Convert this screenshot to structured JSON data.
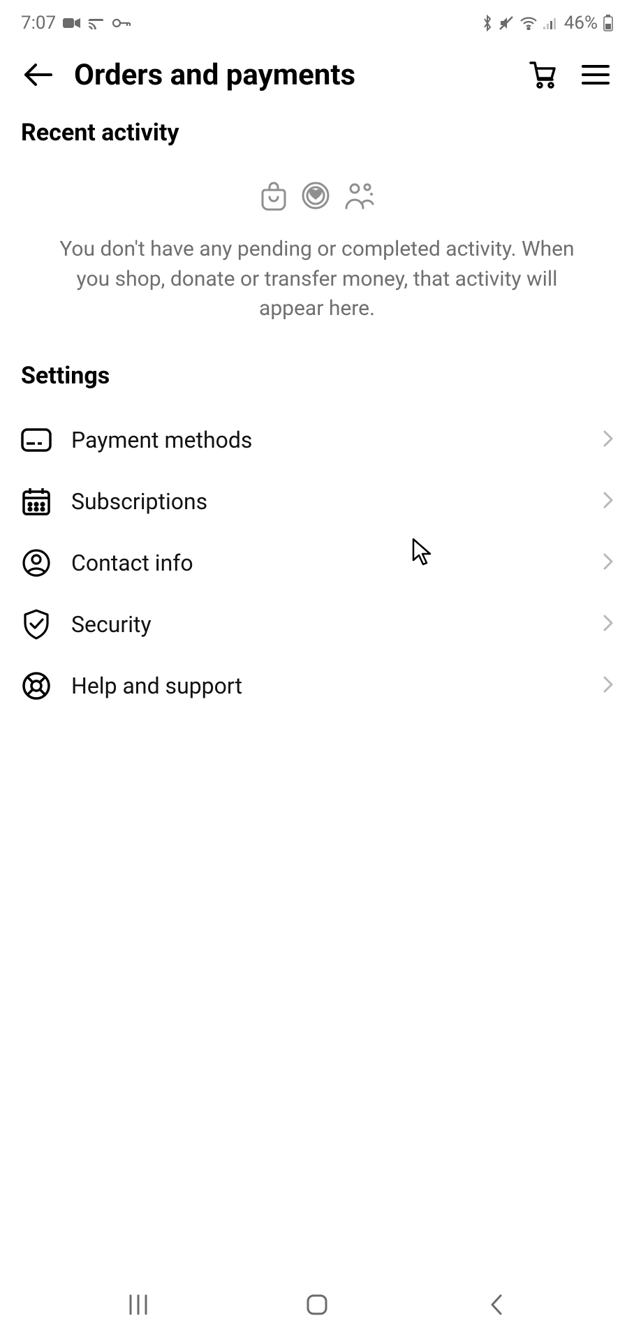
{
  "status_bar": {
    "time": "7:07",
    "battery": "46%"
  },
  "header": {
    "title": "Orders and payments"
  },
  "recent": {
    "title": "Recent activity",
    "empty_text": "You don't have any pending or completed activity. When you shop, donate or transfer money, that activity will appear here."
  },
  "settings": {
    "title": "Settings",
    "items": [
      {
        "label": "Payment methods"
      },
      {
        "label": "Subscriptions"
      },
      {
        "label": "Contact info"
      },
      {
        "label": "Security"
      },
      {
        "label": "Help and support"
      }
    ]
  }
}
